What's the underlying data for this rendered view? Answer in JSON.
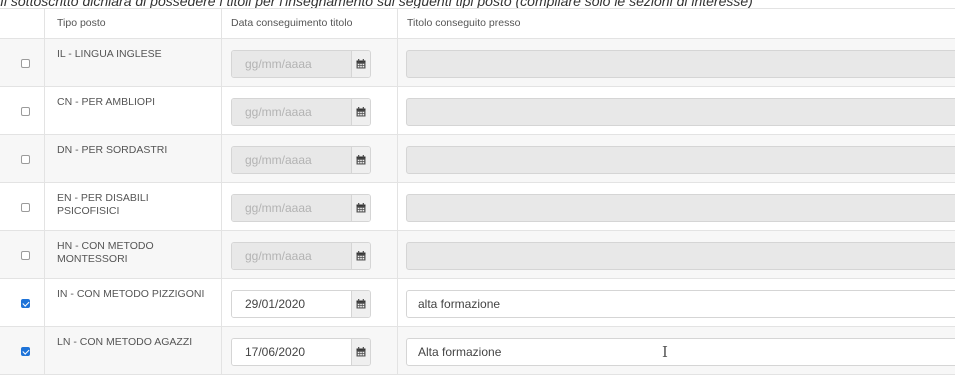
{
  "intro_text": "Il sottoscritto dichiara di possedere i titoli per l'insegnamento sui seguenti tipi posto (compilare solo le sezioni di interesse)",
  "table": {
    "headers": {
      "tipo": "Tipo posto",
      "data": "Data conseguimento titolo",
      "presso": "Titolo conseguito presso"
    },
    "date_placeholder": "gg/mm/aaaa",
    "rows": [
      {
        "tipo": "IL - LINGUA INGLESE",
        "checked": false,
        "date": "",
        "presso": ""
      },
      {
        "tipo": "CN - PER AMBLIOPI",
        "checked": false,
        "date": "",
        "presso": ""
      },
      {
        "tipo": "DN - PER SORDASTRI",
        "checked": false,
        "date": "",
        "presso": ""
      },
      {
        "tipo": "EN - PER DISABILI PSICOFISICI",
        "checked": false,
        "date": "",
        "presso": ""
      },
      {
        "tipo": "HN - CON METODO MONTESSORI",
        "checked": false,
        "date": "",
        "presso": ""
      },
      {
        "tipo": "IN - CON METODO PIZZIGONI",
        "checked": true,
        "date": "29/01/2020",
        "presso": "alta formazione"
      },
      {
        "tipo": "LN - CON METODO AGAZZI",
        "checked": true,
        "date": "17/06/2020",
        "presso": "Alta formazione"
      }
    ]
  },
  "icons": {
    "calendar": "calendar-icon",
    "checkbox": "checkbox-icon",
    "cursor": "text-cursor-icon"
  },
  "colors": {
    "checkbox_checked": "#1e73d8",
    "disabled_field": "#e8e8e8",
    "stripe": "#f7f7f7"
  }
}
